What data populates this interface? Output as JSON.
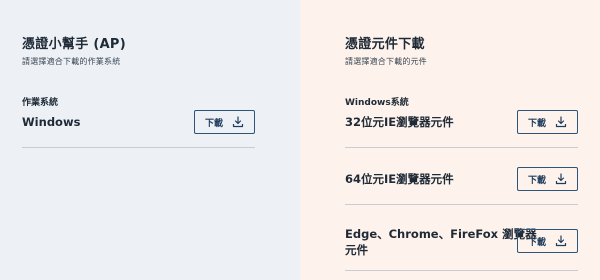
{
  "left": {
    "title": "憑證小幫手 (AP)",
    "subtitle": "請選擇適合下載的作業系統",
    "section_label": "作業系統",
    "items": [
      {
        "name": "Windows",
        "button_label": "下載",
        "icon": "download-icon"
      }
    ]
  },
  "right": {
    "title": "憑證元件下載",
    "subtitle": "請選擇適合下載的元件",
    "section_label": "Windows系統",
    "items": [
      {
        "name": "32位元IE瀏覽器元件",
        "button_label": "下載",
        "icon": "download-icon"
      },
      {
        "name": "64位元IE瀏覽器元件",
        "button_label": "下載",
        "icon": "download-icon"
      },
      {
        "name_line1": "Edge、Chrome、FireFox 瀏覽器",
        "name_line2": "元件",
        "button_label": "下載",
        "icon": "download-icon"
      }
    ]
  },
  "colors": {
    "left_background": "#edf1f6",
    "right_background": "#fdf3ec",
    "button_border": "#2d5479",
    "text": "#1f2a36",
    "divider": "#c6ccd3"
  }
}
